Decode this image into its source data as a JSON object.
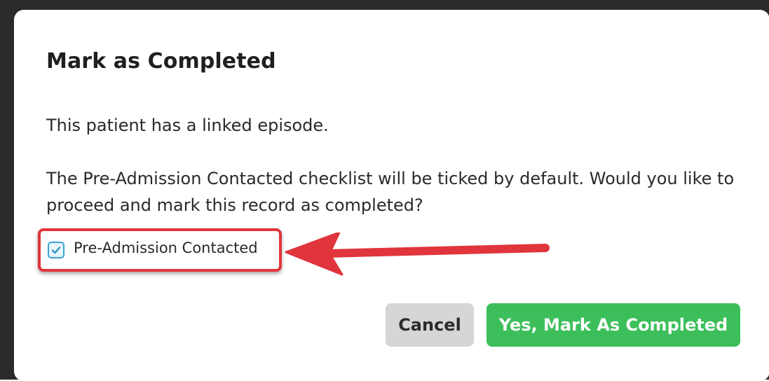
{
  "dialog": {
    "title": "Mark as Completed",
    "message_1": "This patient has a linked episode.",
    "message_2": "The Pre-Admission Contacted checklist will be ticked by default. Would you like to proceed and mark this record as completed?",
    "checkbox": {
      "label": "Pre-Admission Contacted",
      "checked": true
    },
    "buttons": {
      "cancel_label": "Cancel",
      "confirm_label": "Yes, Mark As Completed"
    }
  },
  "colors": {
    "confirm_button": "#3cbf5a",
    "cancel_button": "#d6d6d6",
    "annotation_highlight": "#e0353c",
    "checkbox_accent": "#3aa3d4"
  },
  "icons": {
    "checkbox": "checkmark-icon",
    "annotation": "annotation-arrow-icon"
  }
}
